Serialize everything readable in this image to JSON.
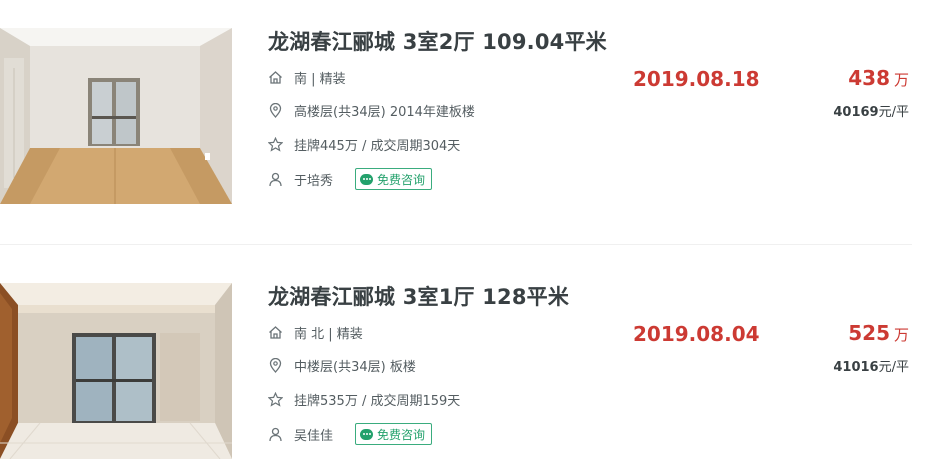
{
  "listings": [
    {
      "title": "龙湖春江郦城 3室2厅 109.04平米",
      "house_info": "南 | 精装",
      "position_info": "高楼层(共34层) 2014年建板楼",
      "deal_cycle": "挂牌445万 / 成交周期304天",
      "agent": "于培秀",
      "consult_label": "免费咨询",
      "deal_date": "2019.08.18",
      "total_price": "438",
      "total_unit": "万",
      "unit_price": "40169",
      "unit_price_suffix": "元/平"
    },
    {
      "title": "龙湖春江郦城 3室1厅 128平米",
      "house_info": "南 北 | 精装",
      "position_info": "中楼层(共34层) 板楼",
      "deal_cycle": "挂牌535万 / 成交周期159天",
      "agent": "吴佳佳",
      "consult_label": "免费咨询",
      "deal_date": "2019.08.04",
      "total_price": "525",
      "total_unit": "万",
      "unit_price": "41016",
      "unit_price_suffix": "元/平"
    }
  ],
  "icons": {
    "house": "house-icon",
    "location": "location-pin-icon",
    "star": "star-icon",
    "person": "person-icon",
    "chat": "chat-bubble-icon"
  },
  "colors": {
    "price_red": "#cc3a33",
    "consult_green": "#23a16c",
    "title_text": "#394043",
    "meta_text": "#545d61"
  }
}
